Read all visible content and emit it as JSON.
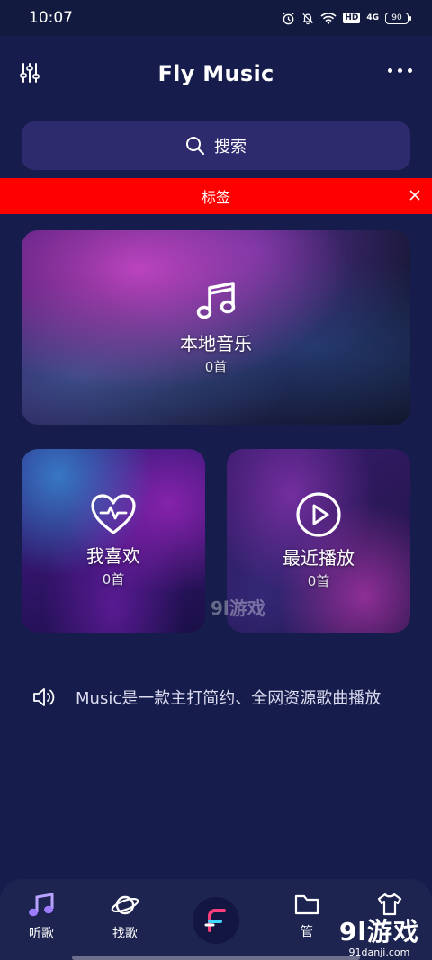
{
  "status_bar": {
    "time": "10:07",
    "hd": "HD",
    "signal": "4G",
    "battery": "90"
  },
  "header": {
    "title": "Fly Music"
  },
  "search": {
    "label": "搜索"
  },
  "banner": {
    "label": "标签"
  },
  "cards": {
    "local": {
      "title": "本地音乐",
      "count": "0首"
    },
    "favorites": {
      "title": "我喜欢",
      "count": "0首"
    },
    "recent": {
      "title": "最近播放",
      "count": "0首"
    }
  },
  "marquee": {
    "text": "Music是一款主打简约、全网资源歌曲播放"
  },
  "bottom_nav": {
    "items": [
      {
        "label": "听歌"
      },
      {
        "label": "找歌"
      },
      {
        "label": ""
      },
      {
        "label": "管"
      },
      {
        "label": ""
      }
    ]
  },
  "watermarks": {
    "center": "9l游戏",
    "corner": "9l游戏",
    "corner_sub": "91danji.com"
  },
  "colors": {
    "background": "#161c4c",
    "search_bg": "#2e2a6e",
    "banner": "#ff0000",
    "nav_bg": "#1e2450"
  }
}
